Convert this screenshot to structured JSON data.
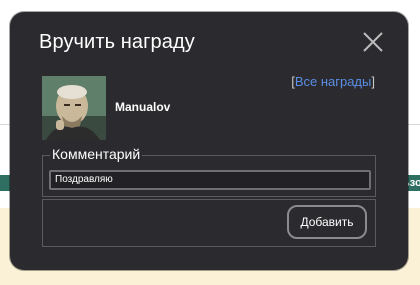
{
  "background": {
    "right_tag_text": "ьзо"
  },
  "dialog": {
    "title": "Вручить награду",
    "close_icon": "close-icon",
    "all_awards": {
      "open_bracket": "[",
      "link_label": "Все награды",
      "close_bracket": "]"
    },
    "recipient": {
      "username": "Manualov",
      "avatar_icon": "user-photo-avatar"
    },
    "comment": {
      "legend": "Комментарий",
      "value": "Поздравляю"
    },
    "submit_label": "Добавить"
  },
  "colors": {
    "modal_background": "#2a2a2f",
    "link": "#5b8ee6",
    "text": "#ffffff"
  }
}
